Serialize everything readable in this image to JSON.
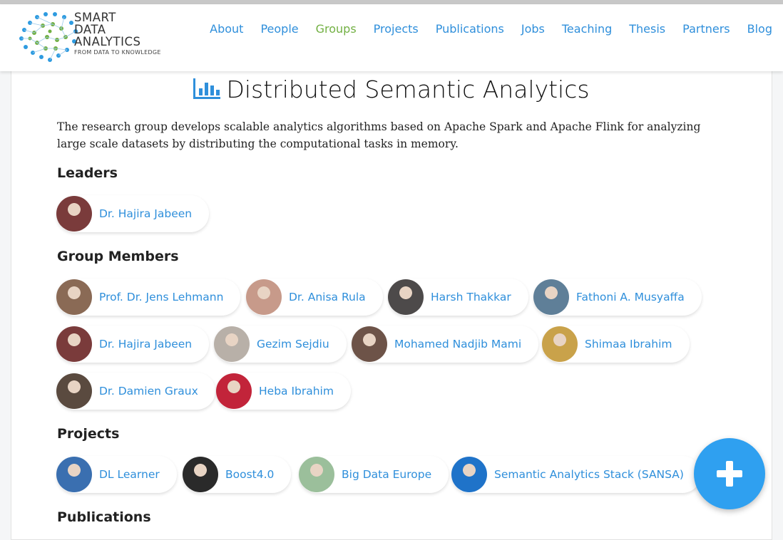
{
  "brand": {
    "line1": "SMART",
    "line2": "DATA",
    "line3": "ANALYTICS",
    "tagline": "FROM DATA TO KNOWLEDGE"
  },
  "nav": [
    {
      "label": "About"
    },
    {
      "label": "People"
    },
    {
      "label": "Groups",
      "active": true
    },
    {
      "label": "Projects"
    },
    {
      "label": "Publications"
    },
    {
      "label": "Jobs"
    },
    {
      "label": "Teaching"
    },
    {
      "label": "Thesis"
    },
    {
      "label": "Partners"
    },
    {
      "label": "Blog"
    }
  ],
  "page": {
    "title": "Distributed Semantic Analytics",
    "description": "The research group develops scalable analytics algorithms based on Apache Spark and Apache Flink for analyzing large scale datasets by distributing the computational tasks in memory."
  },
  "sections": {
    "leaders": "Leaders",
    "members": "Group Members",
    "projects": "Projects",
    "publications": "Publications"
  },
  "leaders": [
    {
      "name": "Dr. Hajira Jabeen",
      "avatar_color": "#7a3b3b"
    }
  ],
  "members": [
    {
      "name": "Prof. Dr. Jens Lehmann",
      "avatar_color": "#8a6a55"
    },
    {
      "name": "Dr. Anisa Rula",
      "avatar_color": "#c79a8a"
    },
    {
      "name": "Harsh Thakkar",
      "avatar_color": "#4d4a4a"
    },
    {
      "name": "Fathoni A. Musyaffa",
      "avatar_color": "#5f7f98"
    },
    {
      "name": "Dr. Hajira Jabeen",
      "avatar_color": "#7a3b3b"
    },
    {
      "name": "Gezim Sejdiu",
      "avatar_color": "#b8b0a8"
    },
    {
      "name": "Mohamed Nadjib Mami",
      "avatar_color": "#6d5348"
    },
    {
      "name": "Shimaa Ibrahim",
      "avatar_color": "#c9a24a"
    },
    {
      "name": "Dr. Damien Graux",
      "avatar_color": "#5a4a3f"
    },
    {
      "name": "Heba Ibrahim",
      "avatar_color": "#c2243a"
    }
  ],
  "projects": [
    {
      "name": "DL Learner",
      "avatar_color": "#3a6fb0"
    },
    {
      "name": "Boost4.0",
      "avatar_color": "#2a2a2a"
    },
    {
      "name": "Big Data Europe",
      "avatar_color": "#9bbf9b"
    },
    {
      "name": "Semantic Analytics Stack (SANSA)",
      "avatar_color": "#1f73c9"
    }
  ],
  "colors": {
    "link": "#2f8fdb",
    "active_nav": "#72b043",
    "fab": "#2fa0f0"
  },
  "icons": {
    "title_icon": "bar-chart-icon",
    "fab_icon": "plus-icon"
  }
}
